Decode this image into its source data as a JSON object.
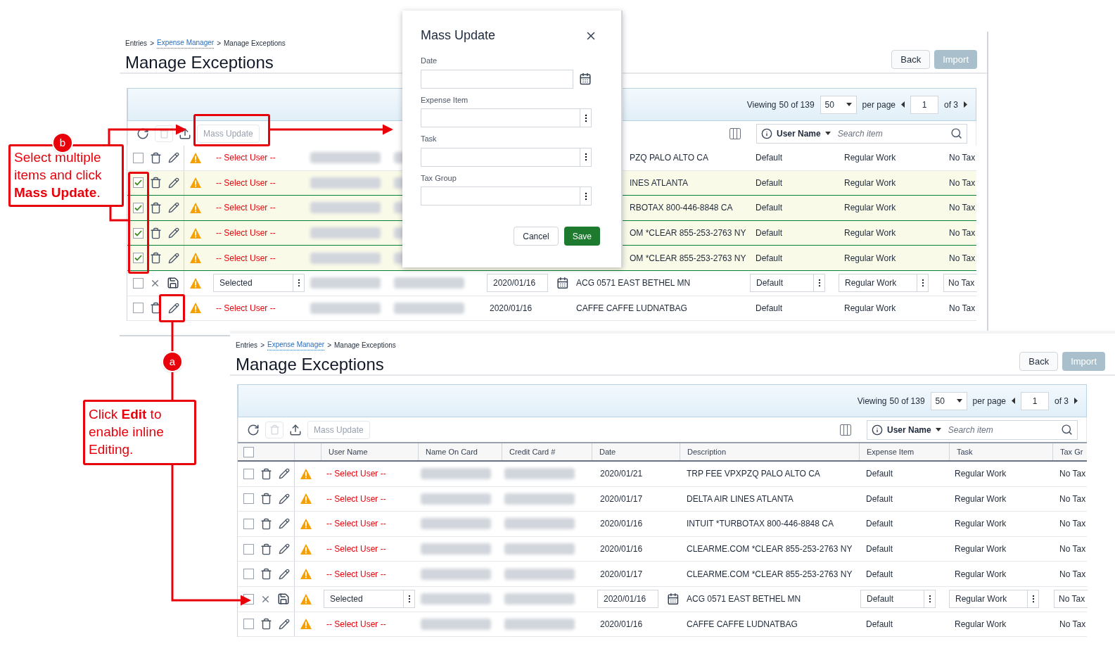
{
  "screens": [
    {
      "breadcrumb": {
        "separator": ">",
        "items": [
          {
            "label": "Entries",
            "link": false
          },
          {
            "label": "Expense Manager",
            "link": true
          },
          {
            "label": "Manage Exceptions",
            "link": false
          }
        ]
      },
      "title": "Manage Exceptions",
      "buttons": [
        {
          "label": "Back",
          "disabled": false
        },
        {
          "label": "Import",
          "disabled": true
        }
      ],
      "pager": {
        "viewing": "Viewing",
        "shown": "50",
        "of": "of",
        "total": "139",
        "per_page_value": "50",
        "per_page": "per page",
        "page": "1",
        "pages": "of 3"
      },
      "mass_update": {
        "label": "Mass Update",
        "disabled": true
      },
      "search": {
        "filter": "User Name",
        "placeholder": "Search item"
      },
      "rows": [
        {
          "checked": false,
          "editing": false,
          "user": "-- Select User --",
          "description": "PZQ PALO ALTO CA",
          "expense_item": "Default",
          "task": "Regular Work",
          "tax_group": "No Tax"
        },
        {
          "checked": true,
          "editing": false,
          "user": "-- Select User --",
          "description": "INES ATLANTA",
          "expense_item": "Default",
          "task": "Regular Work",
          "tax_group": "No Tax"
        },
        {
          "checked": true,
          "editing": false,
          "user": "-- Select User --",
          "description": "RBOTAX 800-446-8848 CA",
          "expense_item": "Default",
          "task": "Regular Work",
          "tax_group": "No Tax"
        },
        {
          "checked": true,
          "editing": false,
          "user": "-- Select User --",
          "description": "OM *CLEAR 855-253-2763 NY",
          "expense_item": "Default",
          "task": "Regular Work",
          "tax_group": "No Tax"
        },
        {
          "checked": true,
          "editing": false,
          "user": "-- Select User --",
          "description": "OM *CLEAR 855-253-2763 NY",
          "expense_item": "Default",
          "task": "Regular Work",
          "tax_group": "No Tax"
        },
        {
          "checked": false,
          "editing": true,
          "user": "Selected",
          "date": "2020/01/16",
          "description": "ACG 0571 EAST BETHEL MN",
          "expense_item": "Default",
          "task": "Regular Work",
          "tax_group": "No Tax"
        },
        {
          "checked": false,
          "editing": false,
          "user": "-- Select User --",
          "date": "2020/01/16",
          "description": "CAFFE CAFFE LUDNATBAG",
          "expense_item": "Default",
          "task": "Regular Work",
          "tax_group": "No Tax"
        }
      ]
    },
    {
      "breadcrumb": {
        "separator": ">",
        "items": [
          {
            "label": "Entries",
            "link": false
          },
          {
            "label": "Expense Manager",
            "link": true
          },
          {
            "label": "Manage Exceptions",
            "link": false
          }
        ]
      },
      "title": "Manage Exceptions",
      "buttons": [
        {
          "label": "Back",
          "disabled": false
        },
        {
          "label": "Import",
          "disabled": true
        }
      ],
      "pager": {
        "viewing": "Viewing",
        "shown": "50",
        "of": "of",
        "total": "139",
        "per_page_value": "50",
        "per_page": "per page",
        "page": "1",
        "pages": "of 3"
      },
      "mass_update": {
        "label": "Mass Update",
        "disabled": true
      },
      "search": {
        "filter": "User Name",
        "placeholder": "Search item"
      },
      "select_all": {
        "checked": false
      },
      "columns": [
        "User Name",
        "Name On Card",
        "Credit Card #",
        "Date",
        "Description",
        "Expense Item",
        "Task",
        "Tax Gr"
      ],
      "rows": [
        {
          "checked": false,
          "editing": false,
          "user": "-- Select User --",
          "date": "2020/01/21",
          "description": "TRP FEE VPXPZQ PALO ALTO CA",
          "expense_item": "Default",
          "task": "Regular Work",
          "tax_group": "No Tax"
        },
        {
          "checked": false,
          "editing": false,
          "user": "-- Select User --",
          "date": "2020/01/17",
          "description": "DELTA AIR LINES ATLANTA",
          "expense_item": "Default",
          "task": "Regular Work",
          "tax_group": "No Tax"
        },
        {
          "checked": false,
          "editing": false,
          "user": "-- Select User --",
          "date": "2020/01/16",
          "description": "INTUIT *TURBOTAX 800-446-8848 CA",
          "expense_item": "Default",
          "task": "Regular Work",
          "tax_group": "No Tax"
        },
        {
          "checked": false,
          "editing": false,
          "user": "-- Select User --",
          "date": "2020/01/16",
          "description": "CLEARME.COM *CLEAR 855-253-2763 NY",
          "expense_item": "Default",
          "task": "Regular Work",
          "tax_group": "No Tax"
        },
        {
          "checked": false,
          "editing": false,
          "user": "-- Select User --",
          "date": "2020/01/17",
          "description": "CLEARME.COM *CLEAR 855-253-2763 NY",
          "expense_item": "Default",
          "task": "Regular Work",
          "tax_group": "No Tax"
        },
        {
          "checked": false,
          "editing": true,
          "user": "Selected",
          "date": "2020/01/16",
          "description": "ACG 0571 EAST BETHEL MN",
          "expense_item": "Default",
          "task": "Regular Work",
          "tax_group": "No Tax"
        },
        {
          "checked": false,
          "editing": false,
          "user": "-- Select User --",
          "date": "2020/01/16",
          "description": "CAFFE CAFFE LUDNATBAG",
          "expense_item": "Default",
          "task": "Regular Work",
          "tax_group": "No Tax"
        }
      ]
    }
  ],
  "modal": {
    "title": "Mass Update",
    "fields": [
      {
        "label": "Date",
        "kind": "date"
      },
      {
        "label": "Expense Item",
        "kind": "lookup"
      },
      {
        "label": "Task",
        "kind": "lookup"
      },
      {
        "label": "Tax Group",
        "kind": "lookup"
      }
    ],
    "buttons": [
      {
        "label": "Cancel",
        "kind": "secondary"
      },
      {
        "label": "Save",
        "kind": "primary"
      }
    ]
  },
  "callouts": [
    {
      "marker": "b",
      "text": "Select multiple items and click **Mass Update**."
    },
    {
      "marker": "a",
      "text": "Click **Edit** to enable inline Editing."
    }
  ]
}
